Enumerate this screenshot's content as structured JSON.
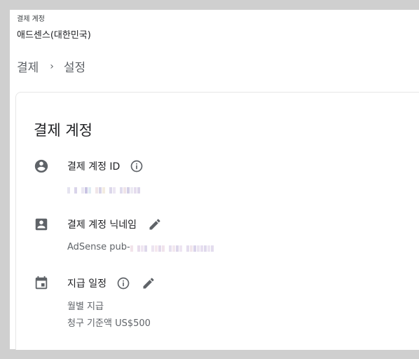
{
  "header": {
    "account_label": "결제 계정",
    "account_value": "애드센스(대한민국)"
  },
  "breadcrumb": {
    "parent": "결제",
    "separator": "›",
    "current": "설정"
  },
  "card": {
    "title": "결제 계정",
    "rows": [
      {
        "label": "결제 계정 ID",
        "icon": "account-circle-icon",
        "has_info": true,
        "has_edit": false,
        "value_redacted": true
      },
      {
        "label": "결제 계정 닉네임",
        "icon": "account-box-icon",
        "has_info": false,
        "has_edit": true,
        "value_prefix": "AdSense pub-",
        "value_redacted": true
      },
      {
        "label": "지급 일정",
        "icon": "calendar-icon",
        "has_info": true,
        "has_edit": true,
        "value_line1": "월별 지급",
        "value_line2": "청구 기준액 US$500"
      }
    ]
  },
  "colors": {
    "background": "#cfcfcf",
    "surface": "#ffffff",
    "text_primary": "#202124",
    "text_secondary": "#5f6368",
    "icon": "#5f6368"
  }
}
